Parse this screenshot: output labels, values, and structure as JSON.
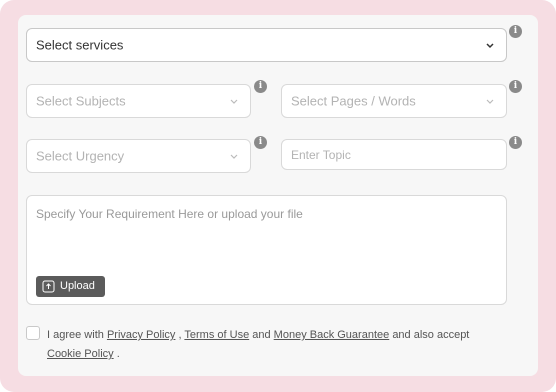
{
  "form": {
    "services": {
      "placeholder": "Select services"
    },
    "subjects": {
      "placeholder": "Select Subjects"
    },
    "pages": {
      "placeholder": "Select Pages / Words"
    },
    "urgency": {
      "placeholder": "Select Urgency"
    },
    "topic": {
      "placeholder": "Enter Topic"
    },
    "requirement": {
      "placeholder": "Specify Your Requirement Here or upload your file"
    },
    "upload_label": "Upload",
    "info_glyph": "i"
  },
  "agreement": {
    "prefix": "I agree with",
    "privacy": "Privacy Policy",
    "sep1": ",",
    "terms": "Terms of Use",
    "and": "and",
    "moneyback": "Money Back Guarantee",
    "middle": "and also accept",
    "cookie": "Cookie Policy",
    "end": "."
  },
  "colors": {
    "frame_bg": "#f6dde3",
    "card_bg": "#f7f7f7",
    "upload_bg": "#5b5b5b",
    "info_bg": "#8a8a8a"
  },
  "icons": [
    "chevron-down-icon",
    "info-icon",
    "upload-icon"
  ]
}
